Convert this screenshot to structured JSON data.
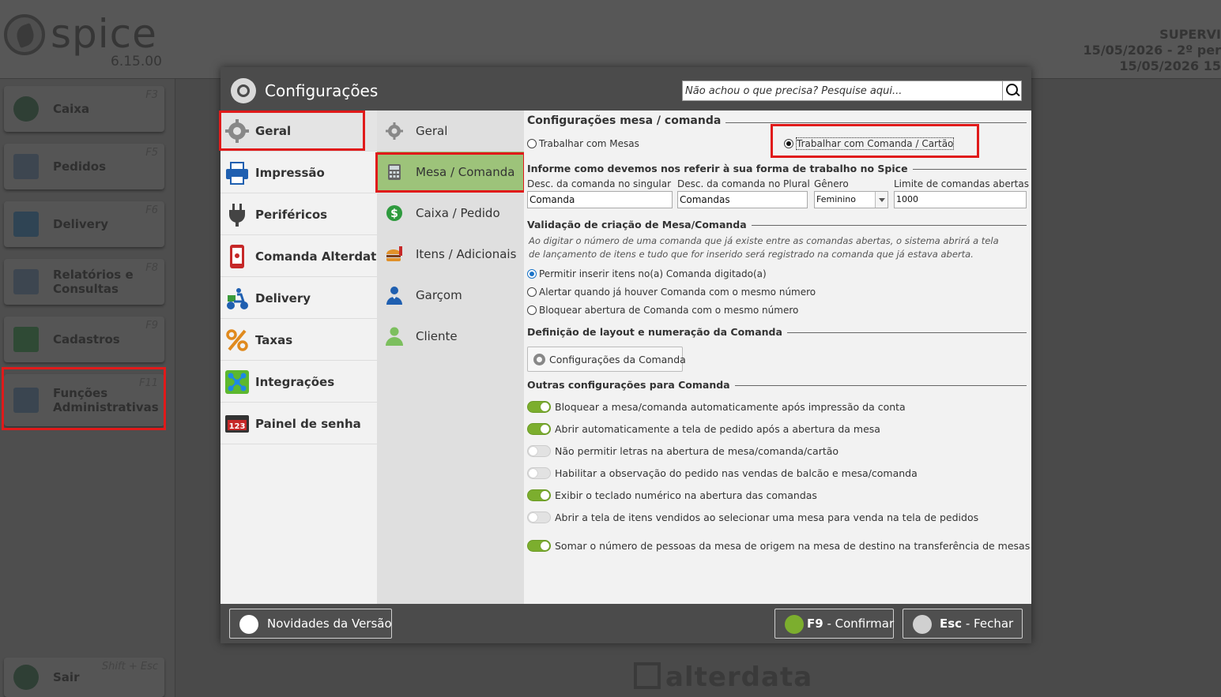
{
  "app": {
    "logo_text": "spice",
    "version": "6.15.00",
    "header_right": [
      "SUPERVI",
      "15/05/2026 - 2º per",
      "15/05/2026 15"
    ],
    "footer_brand": "alterdata"
  },
  "sidebar": {
    "items": [
      {
        "label": "Caixa",
        "key": "F3"
      },
      {
        "label": "Pedidos",
        "key": "F5"
      },
      {
        "label": "Delivery",
        "key": "F6"
      },
      {
        "label": "Relatórios e Consultas",
        "key": "F8"
      },
      {
        "label": "Cadastros",
        "key": "F9"
      },
      {
        "label": "Funções Administrativas",
        "key": "F11"
      },
      {
        "label": "Sair",
        "key": "Shift + Esc"
      }
    ]
  },
  "dialog": {
    "title": "Configurações",
    "search_placeholder": "Não achou o que precisa? Pesquise aqui...",
    "nav1": [
      {
        "label": "Geral",
        "icon": "gear-icon"
      },
      {
        "label": "Impressão",
        "icon": "printer-icon"
      },
      {
        "label": "Periféricos",
        "icon": "plug-icon"
      },
      {
        "label": "Comanda Alterdata",
        "icon": "mobile-icon"
      },
      {
        "label": "Delivery",
        "icon": "delivery-icon"
      },
      {
        "label": "Taxas",
        "icon": "percent-icon"
      },
      {
        "label": "Integrações",
        "icon": "network-icon"
      },
      {
        "label": "Painel de senha",
        "icon": "display-panel-icon"
      }
    ],
    "nav2": [
      {
        "label": "Geral",
        "icon": "gear-icon"
      },
      {
        "label": "Mesa / Comanda",
        "icon": "calculator-icon"
      },
      {
        "label": "Caixa / Pedido",
        "icon": "dollar-icon"
      },
      {
        "label": "Itens / Adicionais",
        "icon": "food-icon"
      },
      {
        "label": "Garçom",
        "icon": "waiter-icon"
      },
      {
        "label": "Cliente",
        "icon": "person-icon"
      }
    ],
    "content": {
      "section1_title": "Configurações mesa / comanda",
      "radio_mesas": "Trabalhar com Mesas",
      "radio_comanda": "Trabalhar com Comanda / Cartão",
      "section2_title": "Informe como devemos nos referir à sua forma de trabalho no Spice",
      "lbl_singular": "Desc. da comanda no singular",
      "val_singular": "Comanda",
      "lbl_plural": "Desc. da comanda no Plural",
      "val_plural": "Comandas",
      "lbl_genero": "Gênero",
      "val_genero": "Feminino",
      "lbl_limite": "Limite de comandas abertas",
      "val_limite": "1000",
      "section3_title": "Validação de criação de Mesa/Comanda",
      "note": "Ao digitar o número de uma comanda que já existe entre as comandas abertas, o sistema abrirá a tela de lançamento de itens e tudo que for inserido será registrado na comanda que já estava aberta.",
      "val_opt1": "Permitir inserir itens no(a) Comanda digitado(a)",
      "val_opt2": "Alertar quando já houver Comanda com o mesmo número",
      "val_opt3": "Bloquear abertura de Comanda com o mesmo número",
      "section4_title": "Definição de layout e numeração da Comanda",
      "cfg_button": "Configurações da Comanda",
      "section5_title": "Outras configurações para Comanda",
      "toggles": [
        {
          "label": "Bloquear a mesa/comanda automaticamente após impressão da conta",
          "on": true
        },
        {
          "label": "Abrir automaticamente a tela de pedido após a abertura da mesa",
          "on": true
        },
        {
          "label": "Não permitir letras na abertura de mesa/comanda/cartão",
          "on": false
        },
        {
          "label": "Habilitar a observação do pedido nas vendas de balcão e mesa/comanda",
          "on": false
        },
        {
          "label": "Exibir o teclado numérico na abertura das comandas",
          "on": true
        },
        {
          "label": "Abrir a tela de itens vendidos ao selecionar uma mesa para venda na tela de pedidos",
          "on": false
        },
        {
          "label": "Somar o número de pessoas da mesa de origem na mesa de destino na transferência de mesas",
          "on": true
        }
      ]
    },
    "footer": {
      "novidades": "Novidades da Versão",
      "confirm_key": "F9",
      "confirm_label": "Confirmar",
      "close_key": "Esc",
      "close_label": "Fechar"
    }
  }
}
